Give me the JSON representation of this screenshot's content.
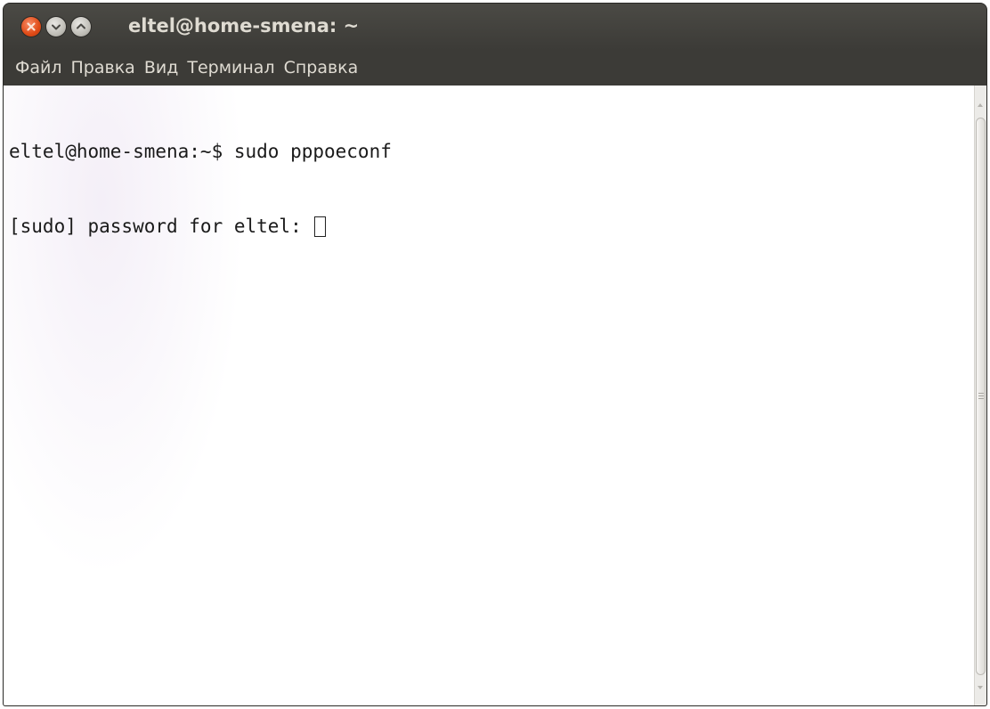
{
  "window": {
    "title": "eltel@home-smena: ~"
  },
  "title_buttons": {
    "close_icon": "close-icon",
    "minimize_icon": "chevron-down-icon",
    "maximize_icon": "chevron-up-icon"
  },
  "menu": {
    "items": [
      {
        "label": "Файл"
      },
      {
        "label": "Правка"
      },
      {
        "label": "Вид"
      },
      {
        "label": "Терминал"
      },
      {
        "label": "Справка"
      }
    ]
  },
  "terminal": {
    "lines": [
      {
        "text": "eltel@home-smena:~$ sudo pppoeconf"
      },
      {
        "text": "[sudo] password for eltel: "
      }
    ]
  },
  "colors": {
    "titlebar": "#3c3b37",
    "title_text": "#dfdbd2",
    "close_button": "#df4a16",
    "terminal_bg": "#ffffff",
    "terminal_text": "#1a1a1a"
  }
}
